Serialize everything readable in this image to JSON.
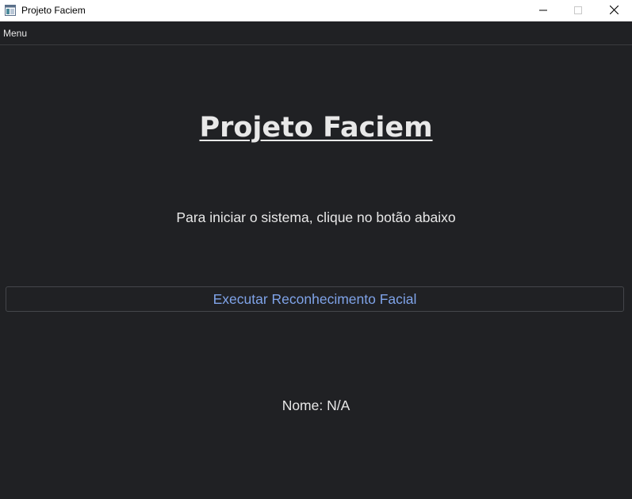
{
  "window": {
    "title": "Projeto Faciem",
    "controls": {
      "minimize_icon": "minimize-icon",
      "maximize_icon": "maximize-icon",
      "close_icon": "close-icon"
    }
  },
  "menubar": {
    "items": [
      {
        "label": "Menu"
      }
    ]
  },
  "main": {
    "heading": "Projeto Faciem",
    "instruction": "Para iniciar o sistema, clique no botão abaixo",
    "run_button_label": "Executar Reconhecimento Facial",
    "name_label": "Nome:",
    "name_value": "N/A"
  },
  "colors": {
    "background": "#202124",
    "text": "#e8e8e8",
    "button_text": "#7fa3e8",
    "button_border": "#44464b",
    "titlebar": "#ffffff"
  }
}
